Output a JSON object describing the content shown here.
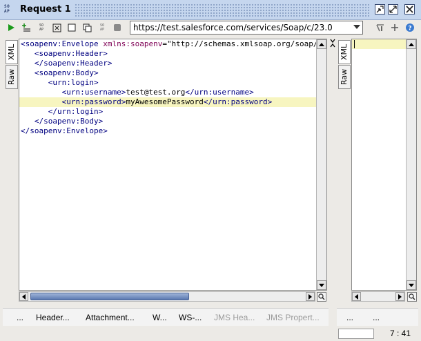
{
  "window": {
    "title": "Request 1",
    "logo_text": "SO\nAP"
  },
  "toolbar": {
    "endpoint_url": "https://test.salesforce.com/services/Soap/c/23.0",
    "buttons": [
      "submit-request",
      "add-assertion",
      "create-empty-request",
      "format-xml",
      "stop",
      "clone",
      "tile",
      "recreate",
      "abort"
    ]
  },
  "request_tabs": {
    "xml": "XML",
    "raw": "Raw"
  },
  "response_tabs": {
    "xml": "XML",
    "raw": "Raw"
  },
  "editor": {
    "lines": [
      {
        "indent": "",
        "parts": [
          [
            "tag",
            "<soapenv:Envelope "
          ],
          [
            "attr",
            "xmlns:soapenv"
          ],
          [
            "txt",
            "="
          ],
          [
            "str",
            "\"http://schemas.xmlsoap.org/soap/envelope/\""
          ]
        ]
      },
      {
        "indent": "   ",
        "parts": [
          [
            "tag",
            "<soapenv:Header>"
          ]
        ]
      },
      {
        "indent": "   ",
        "parts": [
          [
            "tag",
            "</soapenv:Header>"
          ]
        ]
      },
      {
        "indent": "   ",
        "parts": [
          [
            "tag",
            "<soapenv:Body>"
          ]
        ]
      },
      {
        "indent": "      ",
        "parts": [
          [
            "tag",
            "<urn:login>"
          ]
        ]
      },
      {
        "indent": "         ",
        "parts": [
          [
            "tag",
            "<urn:username>"
          ],
          [
            "txt",
            "test@test.org"
          ],
          [
            "tag",
            "</urn:username>"
          ]
        ]
      },
      {
        "indent": "         ",
        "parts": [
          [
            "tag",
            "<urn:password>"
          ],
          [
            "txt",
            "myAwesomePassword"
          ],
          [
            "tag",
            "</urn:password>"
          ]
        ],
        "highlight": true
      },
      {
        "indent": "      ",
        "parts": [
          [
            "tag",
            "</urn:login>"
          ]
        ]
      },
      {
        "indent": "   ",
        "parts": [
          [
            "tag",
            "</soapenv:Body>"
          ]
        ]
      },
      {
        "indent": "",
        "parts": [
          [
            "tag",
            "</soapenv:Envelope>"
          ]
        ]
      }
    ]
  },
  "bottom_tabs": [
    {
      "label": "...",
      "enabled": true
    },
    {
      "label": "Header...",
      "enabled": true
    },
    {
      "label": "Attachment...",
      "enabled": true
    },
    {
      "label": "W...",
      "enabled": true
    },
    {
      "label": "WS-...",
      "enabled": true
    },
    {
      "label": "JMS Hea...",
      "enabled": false
    },
    {
      "label": "JMS Propert...",
      "enabled": false
    }
  ],
  "response_bottom_tabs": [
    "...",
    "..."
  ],
  "status": {
    "cursor_position": "7 : 41"
  },
  "colors": {
    "titlebar": "#c5d6ee",
    "highlight_line": "#f7f5c0",
    "tag": "#000080",
    "attr": "#7f0055"
  }
}
